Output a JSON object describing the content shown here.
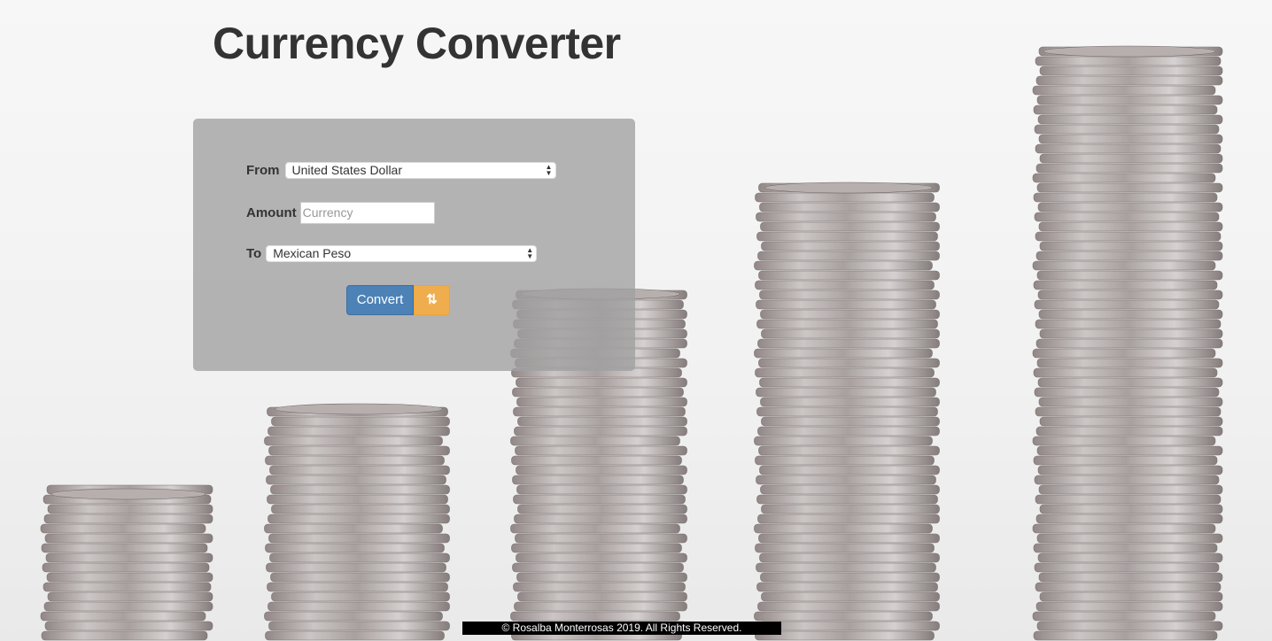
{
  "page": {
    "title": "Currency Converter"
  },
  "form": {
    "from_label": "From",
    "from_value": "United States Dollar",
    "amount_label": "Amount",
    "amount_placeholder": "Currency",
    "to_label": "To",
    "to_value": "Mexican Peso",
    "convert_label": "Convert",
    "swap_icon": "swap-vertical-arrows"
  },
  "footer": {
    "text": "© Rosalba Monterrosas 2019. All Rights Reserved."
  },
  "colors": {
    "convert_button": "#4c82b6",
    "swap_button": "#f0ad4e",
    "panel": "#a0a0a0",
    "title": "#333333"
  }
}
